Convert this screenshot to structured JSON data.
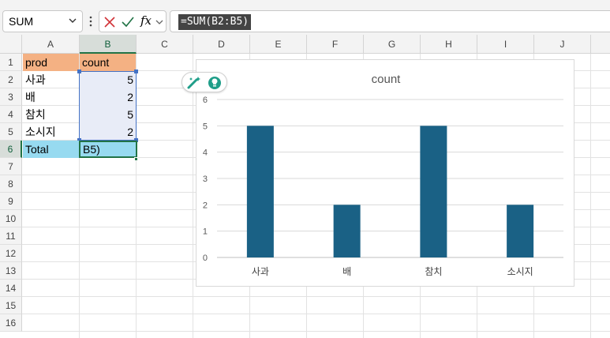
{
  "formula_bar": {
    "namebox_value": "SUM",
    "formula": "=SUM(B2:B5)",
    "fx_label": "fx"
  },
  "columns": [
    "A",
    "B",
    "C",
    "D",
    "E",
    "F",
    "G",
    "H",
    "I",
    "J"
  ],
  "rows": [
    "1",
    "2",
    "3",
    "4",
    "5",
    "6",
    "7",
    "8",
    "9",
    "10",
    "11",
    "12",
    "13",
    "14",
    "15",
    "16"
  ],
  "cells": {
    "A1": "prod",
    "B1": "count",
    "A2": "사과",
    "B2": "5",
    "A3": "배",
    "B3": "2",
    "A4": "참치",
    "B4": "5",
    "A5": "소시지",
    "B5": "2",
    "A6": "Total",
    "B6": "B5)"
  },
  "colors": {
    "header_fill": "#f4b183",
    "range_fill": "#e8ecf7",
    "total_fill": "#97daf0",
    "bar": "#1a6185",
    "accent": "#217346"
  },
  "chart_data": {
    "type": "bar",
    "title": "count",
    "categories": [
      "사과",
      "배",
      "참치",
      "소시지"
    ],
    "values": [
      5,
      2,
      5,
      2
    ],
    "ylim": [
      0,
      6
    ],
    "yticks": [
      0,
      1,
      2,
      3,
      4,
      5,
      6
    ],
    "grid": true,
    "legend": "none"
  }
}
